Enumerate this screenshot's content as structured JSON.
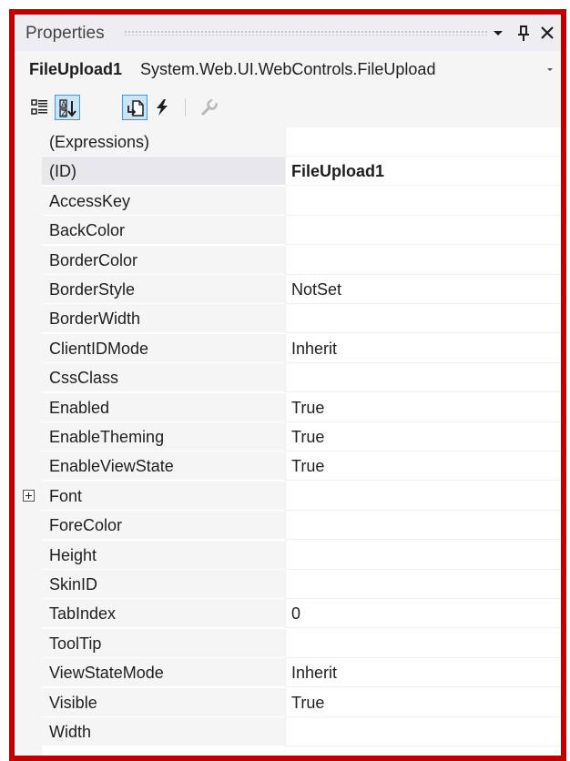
{
  "window": {
    "title": "Properties",
    "dropdown_glyph": "▾",
    "pin_glyph": "🖈",
    "close_glyph": "✕"
  },
  "selector": {
    "object_name": "FileUpload1",
    "object_type": "System.Web.UI.WebControls.FileUpload"
  },
  "toolbar": {
    "buttons": [
      {
        "name": "categorized-icon",
        "active": false
      },
      {
        "name": "alphabetical-icon",
        "active": true
      },
      {
        "name": "properties-icon",
        "active": true
      },
      {
        "name": "events-icon",
        "active": false
      },
      {
        "name": "property-pages-icon",
        "active": false,
        "disabled": true
      }
    ]
  },
  "properties": [
    {
      "name": "(Expressions)",
      "value": ""
    },
    {
      "name": "(ID)",
      "value": "FileUpload1",
      "bold": true,
      "selected": true
    },
    {
      "name": "AccessKey",
      "value": ""
    },
    {
      "name": "BackColor",
      "value": ""
    },
    {
      "name": "BorderColor",
      "value": ""
    },
    {
      "name": "BorderStyle",
      "value": "NotSet"
    },
    {
      "name": "BorderWidth",
      "value": ""
    },
    {
      "name": "ClientIDMode",
      "value": "Inherit"
    },
    {
      "name": "CssClass",
      "value": ""
    },
    {
      "name": "Enabled",
      "value": "True"
    },
    {
      "name": "EnableTheming",
      "value": "True"
    },
    {
      "name": "EnableViewState",
      "value": "True"
    },
    {
      "name": "Font",
      "value": "",
      "expandable": true
    },
    {
      "name": "ForeColor",
      "value": ""
    },
    {
      "name": "Height",
      "value": ""
    },
    {
      "name": "SkinID",
      "value": ""
    },
    {
      "name": "TabIndex",
      "value": "0"
    },
    {
      "name": "ToolTip",
      "value": ""
    },
    {
      "name": "ViewStateMode",
      "value": "Inherit"
    },
    {
      "name": "Visible",
      "value": "True"
    },
    {
      "name": "Width",
      "value": ""
    }
  ],
  "colors": {
    "frame_border": "#c00000",
    "selection_blue": "#3399ff"
  }
}
